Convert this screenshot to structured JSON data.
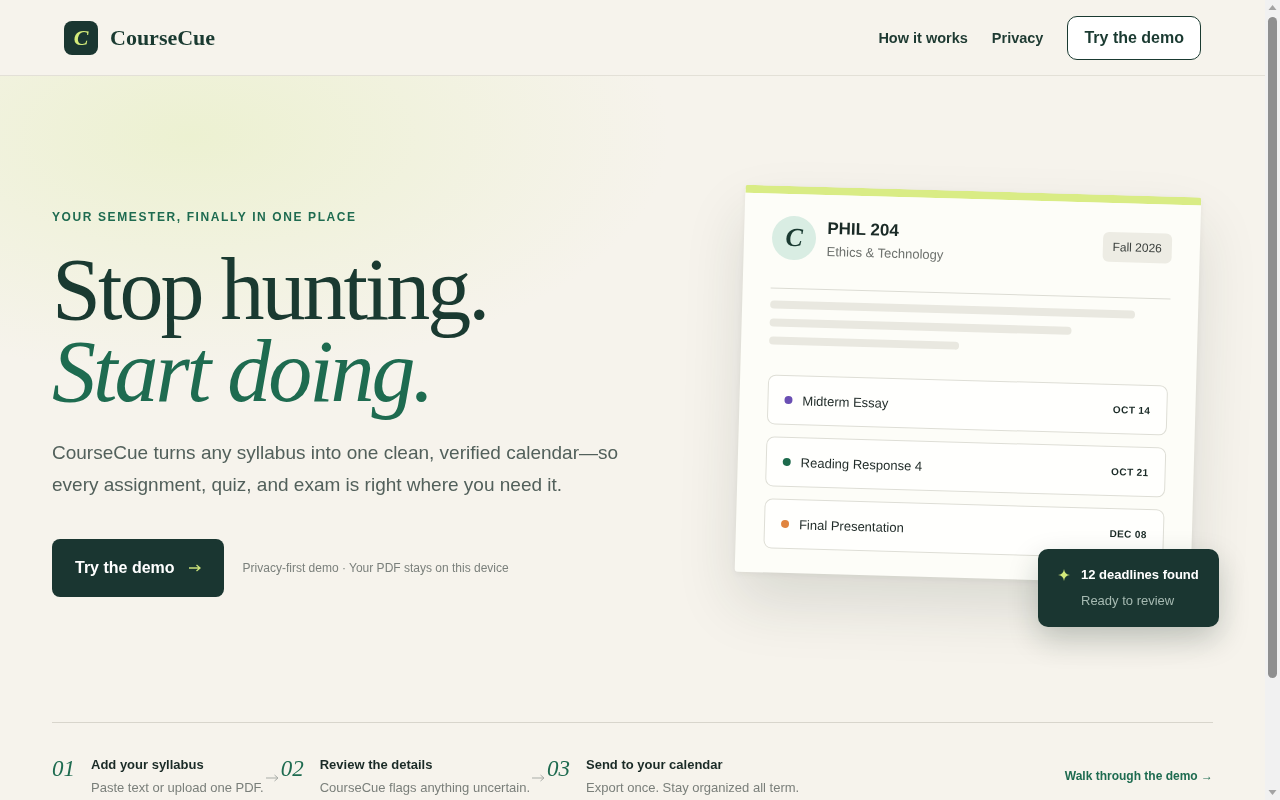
{
  "header": {
    "logo_letter": "C",
    "brand": "CourseCue",
    "nav": [
      {
        "label": "How it works"
      },
      {
        "label": "Privacy"
      }
    ],
    "cta": "Try the demo"
  },
  "hero": {
    "eyebrow": "YOUR SEMESTER, FINALLY IN ONE PLACE",
    "headline": [
      {
        "text": "Stop hunting.",
        "kind": "plain"
      },
      {
        "text": "Start doing.",
        "kind": "accent"
      }
    ],
    "description": "CourseCue turns any syllabus into one clean, verified calendar—so every assignment, quiz, and exam is right where you need it.",
    "cta": "Try the demo",
    "note": "Privacy-first demo · Your PDF stays on this device"
  },
  "preview_card": {
    "avatar_letter": "C",
    "course_code": "PHIL 204",
    "course_title": "Ethics & Technology",
    "term": "Fall 2026",
    "deadlines": [
      {
        "title": "Midterm Essay",
        "date": "OCT 14",
        "color": "#6a4fb3"
      },
      {
        "title": "Reading Response 4",
        "date": "OCT 21",
        "color": "#1d6a4c"
      },
      {
        "title": "Final Presentation",
        "date": "DEC 08",
        "color": "#e0843f"
      }
    ]
  },
  "summary_badge": {
    "title": "12 deadlines found",
    "subtitle": "Ready to review"
  },
  "steps": [
    {
      "number": "01",
      "title": "Add your syllabus",
      "description": "Paste text or upload one PDF."
    },
    {
      "number": "02",
      "title": "Review the details",
      "description": "CourseCue flags anything uncertain."
    },
    {
      "number": "03",
      "title": "Send to your calendar",
      "description": "Export once. Stay organized all term."
    }
  ],
  "walkthrough_link": "Walk through the demo →"
}
